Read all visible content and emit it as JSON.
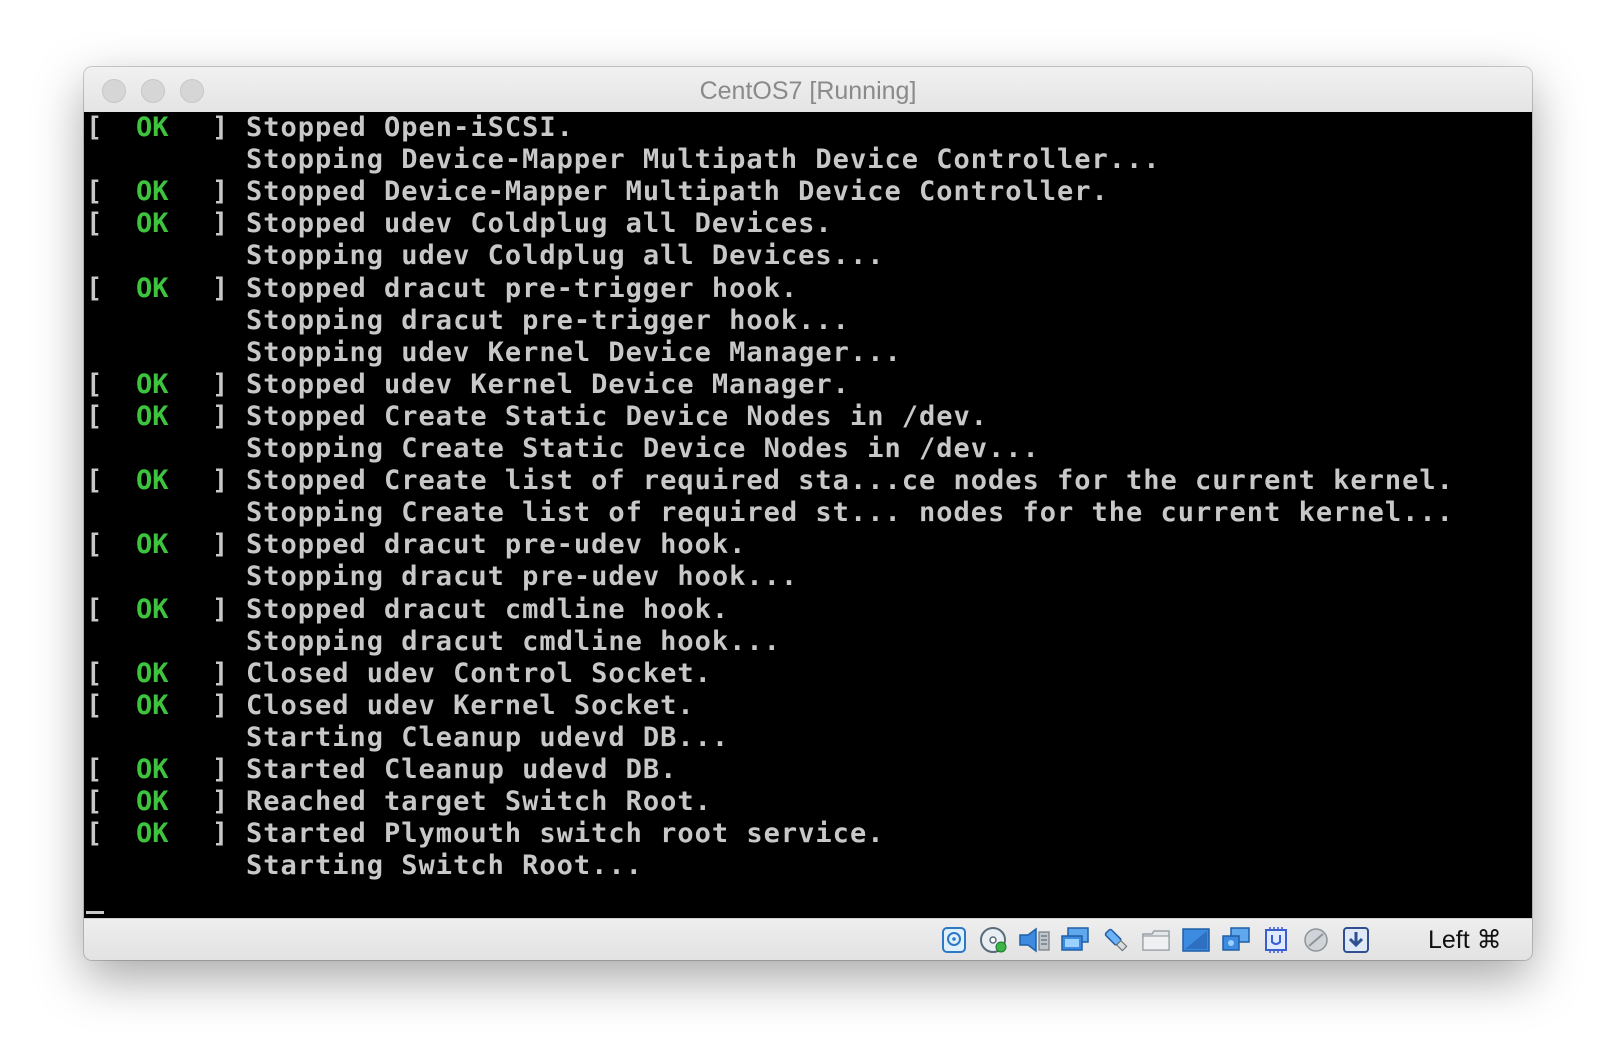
{
  "window": {
    "title": "CentOS7 [Running]"
  },
  "console": {
    "lines": [
      {
        "ok": true,
        "text": "Stopped Open-iSCSI."
      },
      {
        "ok": false,
        "text": "Stopping Device-Mapper Multipath Device Controller..."
      },
      {
        "ok": true,
        "text": "Stopped Device-Mapper Multipath Device Controller."
      },
      {
        "ok": true,
        "text": "Stopped udev Coldplug all Devices."
      },
      {
        "ok": false,
        "text": "Stopping udev Coldplug all Devices..."
      },
      {
        "ok": true,
        "text": "Stopped dracut pre-trigger hook."
      },
      {
        "ok": false,
        "text": "Stopping dracut pre-trigger hook..."
      },
      {
        "ok": false,
        "text": "Stopping udev Kernel Device Manager..."
      },
      {
        "ok": true,
        "text": "Stopped udev Kernel Device Manager."
      },
      {
        "ok": true,
        "text": "Stopped Create Static Device Nodes in /dev."
      },
      {
        "ok": false,
        "text": "Stopping Create Static Device Nodes in /dev..."
      },
      {
        "ok": true,
        "text": "Stopped Create list of required sta...ce nodes for the current kernel."
      },
      {
        "ok": false,
        "text": "Stopping Create list of required st... nodes for the current kernel..."
      },
      {
        "ok": true,
        "text": "Stopped dracut pre-udev hook."
      },
      {
        "ok": false,
        "text": "Stopping dracut pre-udev hook..."
      },
      {
        "ok": true,
        "text": "Stopped dracut cmdline hook."
      },
      {
        "ok": false,
        "text": "Stopping dracut cmdline hook..."
      },
      {
        "ok": true,
        "text": "Closed udev Control Socket."
      },
      {
        "ok": true,
        "text": "Closed udev Kernel Socket."
      },
      {
        "ok": false,
        "text": "Starting Cleanup udevd DB..."
      },
      {
        "ok": true,
        "text": "Started Cleanup udevd DB."
      },
      {
        "ok": true,
        "text": "Reached target Switch Root."
      },
      {
        "ok": true,
        "text": "Started Plymouth switch root service."
      },
      {
        "ok": false,
        "text": "Starting Switch Root..."
      }
    ],
    "status_open": "[",
    "status_ok": "OK",
    "status_close": "]",
    "ok_color": "#3ec33e",
    "text_color": "#c8c8c8"
  },
  "statusbar": {
    "icons": [
      "hard-disk-icon",
      "optical-drive-icon",
      "audio-icon",
      "network-icon",
      "usb-icon",
      "shared-folders-icon",
      "display-icon",
      "video-capture-icon",
      "cpu-icon",
      "mouse-integration-icon",
      "keyboard-capture-icon"
    ],
    "host_key": "Left ⌘"
  }
}
